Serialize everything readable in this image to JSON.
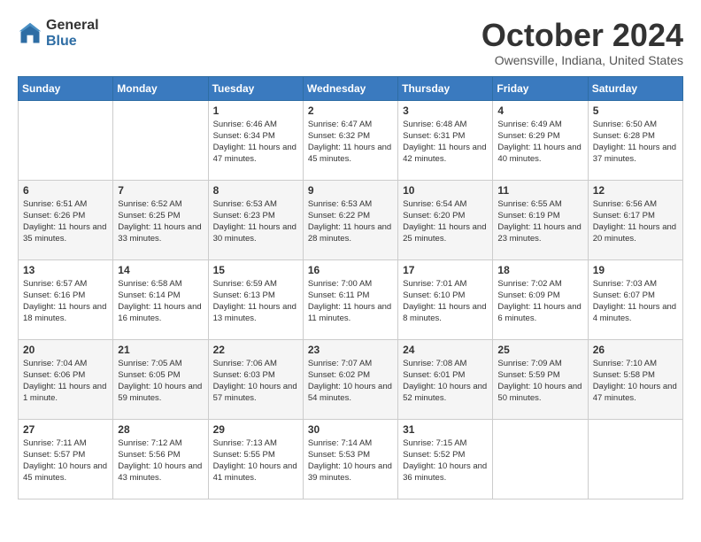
{
  "logo": {
    "general": "General",
    "blue": "Blue"
  },
  "title": "October 2024",
  "location": "Owensville, Indiana, United States",
  "days_of_week": [
    "Sunday",
    "Monday",
    "Tuesday",
    "Wednesday",
    "Thursday",
    "Friday",
    "Saturday"
  ],
  "weeks": [
    [
      {
        "day": "",
        "info": ""
      },
      {
        "day": "",
        "info": ""
      },
      {
        "day": "1",
        "info": "Sunrise: 6:46 AM\nSunset: 6:34 PM\nDaylight: 11 hours and 47 minutes."
      },
      {
        "day": "2",
        "info": "Sunrise: 6:47 AM\nSunset: 6:32 PM\nDaylight: 11 hours and 45 minutes."
      },
      {
        "day": "3",
        "info": "Sunrise: 6:48 AM\nSunset: 6:31 PM\nDaylight: 11 hours and 42 minutes."
      },
      {
        "day": "4",
        "info": "Sunrise: 6:49 AM\nSunset: 6:29 PM\nDaylight: 11 hours and 40 minutes."
      },
      {
        "day": "5",
        "info": "Sunrise: 6:50 AM\nSunset: 6:28 PM\nDaylight: 11 hours and 37 minutes."
      }
    ],
    [
      {
        "day": "6",
        "info": "Sunrise: 6:51 AM\nSunset: 6:26 PM\nDaylight: 11 hours and 35 minutes."
      },
      {
        "day": "7",
        "info": "Sunrise: 6:52 AM\nSunset: 6:25 PM\nDaylight: 11 hours and 33 minutes."
      },
      {
        "day": "8",
        "info": "Sunrise: 6:53 AM\nSunset: 6:23 PM\nDaylight: 11 hours and 30 minutes."
      },
      {
        "day": "9",
        "info": "Sunrise: 6:53 AM\nSunset: 6:22 PM\nDaylight: 11 hours and 28 minutes."
      },
      {
        "day": "10",
        "info": "Sunrise: 6:54 AM\nSunset: 6:20 PM\nDaylight: 11 hours and 25 minutes."
      },
      {
        "day": "11",
        "info": "Sunrise: 6:55 AM\nSunset: 6:19 PM\nDaylight: 11 hours and 23 minutes."
      },
      {
        "day": "12",
        "info": "Sunrise: 6:56 AM\nSunset: 6:17 PM\nDaylight: 11 hours and 20 minutes."
      }
    ],
    [
      {
        "day": "13",
        "info": "Sunrise: 6:57 AM\nSunset: 6:16 PM\nDaylight: 11 hours and 18 minutes."
      },
      {
        "day": "14",
        "info": "Sunrise: 6:58 AM\nSunset: 6:14 PM\nDaylight: 11 hours and 16 minutes."
      },
      {
        "day": "15",
        "info": "Sunrise: 6:59 AM\nSunset: 6:13 PM\nDaylight: 11 hours and 13 minutes."
      },
      {
        "day": "16",
        "info": "Sunrise: 7:00 AM\nSunset: 6:11 PM\nDaylight: 11 hours and 11 minutes."
      },
      {
        "day": "17",
        "info": "Sunrise: 7:01 AM\nSunset: 6:10 PM\nDaylight: 11 hours and 8 minutes."
      },
      {
        "day": "18",
        "info": "Sunrise: 7:02 AM\nSunset: 6:09 PM\nDaylight: 11 hours and 6 minutes."
      },
      {
        "day": "19",
        "info": "Sunrise: 7:03 AM\nSunset: 6:07 PM\nDaylight: 11 hours and 4 minutes."
      }
    ],
    [
      {
        "day": "20",
        "info": "Sunrise: 7:04 AM\nSunset: 6:06 PM\nDaylight: 11 hours and 1 minute."
      },
      {
        "day": "21",
        "info": "Sunrise: 7:05 AM\nSunset: 6:05 PM\nDaylight: 10 hours and 59 minutes."
      },
      {
        "day": "22",
        "info": "Sunrise: 7:06 AM\nSunset: 6:03 PM\nDaylight: 10 hours and 57 minutes."
      },
      {
        "day": "23",
        "info": "Sunrise: 7:07 AM\nSunset: 6:02 PM\nDaylight: 10 hours and 54 minutes."
      },
      {
        "day": "24",
        "info": "Sunrise: 7:08 AM\nSunset: 6:01 PM\nDaylight: 10 hours and 52 minutes."
      },
      {
        "day": "25",
        "info": "Sunrise: 7:09 AM\nSunset: 5:59 PM\nDaylight: 10 hours and 50 minutes."
      },
      {
        "day": "26",
        "info": "Sunrise: 7:10 AM\nSunset: 5:58 PM\nDaylight: 10 hours and 47 minutes."
      }
    ],
    [
      {
        "day": "27",
        "info": "Sunrise: 7:11 AM\nSunset: 5:57 PM\nDaylight: 10 hours and 45 minutes."
      },
      {
        "day": "28",
        "info": "Sunrise: 7:12 AM\nSunset: 5:56 PM\nDaylight: 10 hours and 43 minutes."
      },
      {
        "day": "29",
        "info": "Sunrise: 7:13 AM\nSunset: 5:55 PM\nDaylight: 10 hours and 41 minutes."
      },
      {
        "day": "30",
        "info": "Sunrise: 7:14 AM\nSunset: 5:53 PM\nDaylight: 10 hours and 39 minutes."
      },
      {
        "day": "31",
        "info": "Sunrise: 7:15 AM\nSunset: 5:52 PM\nDaylight: 10 hours and 36 minutes."
      },
      {
        "day": "",
        "info": ""
      },
      {
        "day": "",
        "info": ""
      }
    ]
  ]
}
